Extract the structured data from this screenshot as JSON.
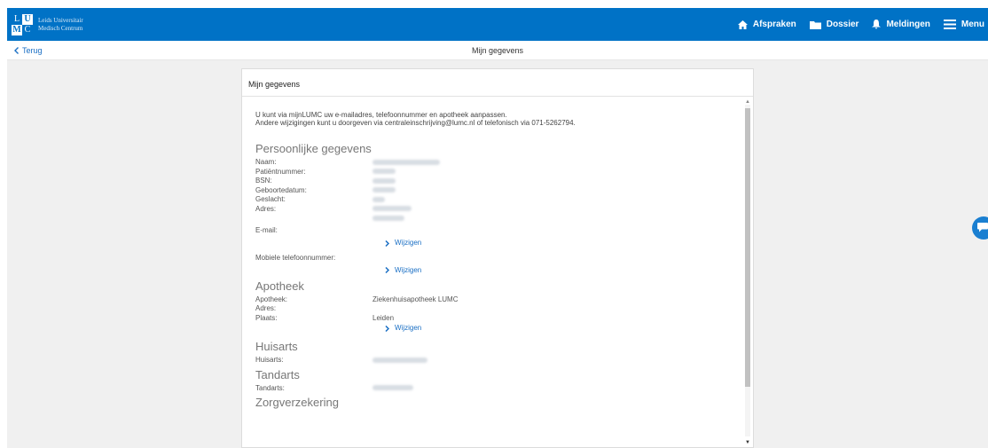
{
  "header": {
    "logo": {
      "l1": "L",
      "l2": "U",
      "l3": "M",
      "l4": "C",
      "name_line1": "Leids Universitair",
      "name_line2": "Medisch Centrum"
    },
    "nav": [
      {
        "label": "Afspraken",
        "icon": "home-icon"
      },
      {
        "label": "Dossier",
        "icon": "folder-icon"
      },
      {
        "label": "Meldingen",
        "icon": "bell-icon"
      },
      {
        "label": "Menu",
        "icon": "hamburger-icon"
      }
    ],
    "brand_color": "#0072c6"
  },
  "subheader": {
    "back_label": "Terug",
    "title": "Mijn gegevens"
  },
  "card": {
    "title": "Mijn gegevens",
    "intro_line1": "U kunt via mijnLUMC uw e-mailadres, telefoonnummer en apotheek aanpassen.",
    "intro_line2": "Andere wijzigingen kunt u doorgeven via centraleinschrijving@lumc.nl of telefonisch via 071-5262794.",
    "personal": {
      "title": "Persoonlijke gegevens",
      "fields": [
        "Naam:",
        "Patiëntnummer:",
        "BSN:",
        "Geboortedatum:",
        "Geslacht:",
        "Adres:"
      ],
      "email_label": "E-mail:",
      "phone_label": "Mobiele telefoonnummer:",
      "edit_label": "Wijzigen"
    },
    "pharmacy": {
      "title": "Apotheek",
      "label_pharmacy": "Apotheek:",
      "value_pharmacy": "Ziekenhuisapotheek LUMC",
      "label_address": "Adres:",
      "label_city": "Plaats:",
      "value_city": "Leiden",
      "edit_label": "Wijzigen"
    },
    "gp": {
      "title": "Huisarts",
      "label": "Huisarts:"
    },
    "dentist": {
      "title": "Tandarts",
      "label": "Tandarts:"
    },
    "insurance": {
      "title": "Zorgverzekering"
    }
  }
}
